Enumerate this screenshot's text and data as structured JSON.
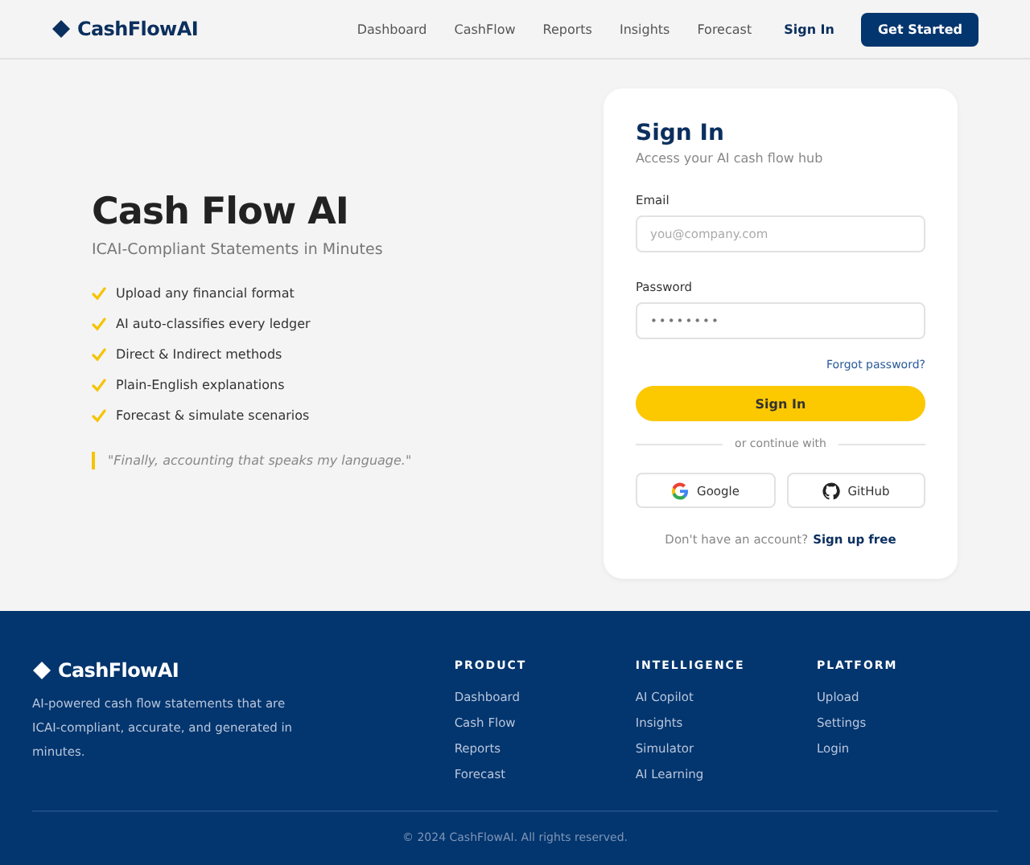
{
  "header": {
    "logo": "CashFlowAI",
    "nav": [
      "Dashboard",
      "CashFlow",
      "Reports",
      "Insights",
      "Forecast"
    ],
    "sign_in": "Sign In",
    "cta": "Get Started"
  },
  "hero": {
    "title": "Cash Flow AI",
    "subtitle": "ICAI-Compliant Statements in Minutes",
    "features": [
      "Upload any financial format",
      "AI auto-classifies every ledger",
      "Direct & Indirect methods",
      "Plain-English explanations",
      "Forecast & simulate scenarios"
    ],
    "quote": "\"Finally, accounting that speaks my language.\""
  },
  "signin": {
    "title": "Sign In",
    "subtitle": "Access your AI cash flow hub",
    "fields": [
      {
        "label": "Email",
        "placeholder": "you@company.com"
      },
      {
        "label": "Password",
        "value": "••••••••"
      }
    ],
    "forgot": "Forgot password?",
    "submit": "Sign In",
    "divider": "or continue with",
    "providers": [
      {
        "kind": "google",
        "label": "Google"
      },
      {
        "kind": "github",
        "label": "GitHub"
      }
    ],
    "signup_prompt": "Don't have an account?",
    "signup_link": "Sign up free"
  },
  "footer": {
    "logo": "CashFlowAI",
    "tagline": "AI-powered cash flow statements that are ICAI-compliant, accurate, and generated in minutes.",
    "columns": [
      {
        "heading": "PRODUCT",
        "links": [
          "Dashboard",
          "Cash Flow",
          "Reports",
          "Forecast"
        ]
      },
      {
        "heading": "INTELLIGENCE",
        "links": [
          "AI Copilot",
          "Insights",
          "Simulator",
          "AI Learning"
        ]
      },
      {
        "heading": "PLATFORM",
        "links": [
          "Upload",
          "Settings",
          "Login"
        ]
      }
    ],
    "copyright": "© 2024 CashFlowAI. All rights reserved."
  }
}
